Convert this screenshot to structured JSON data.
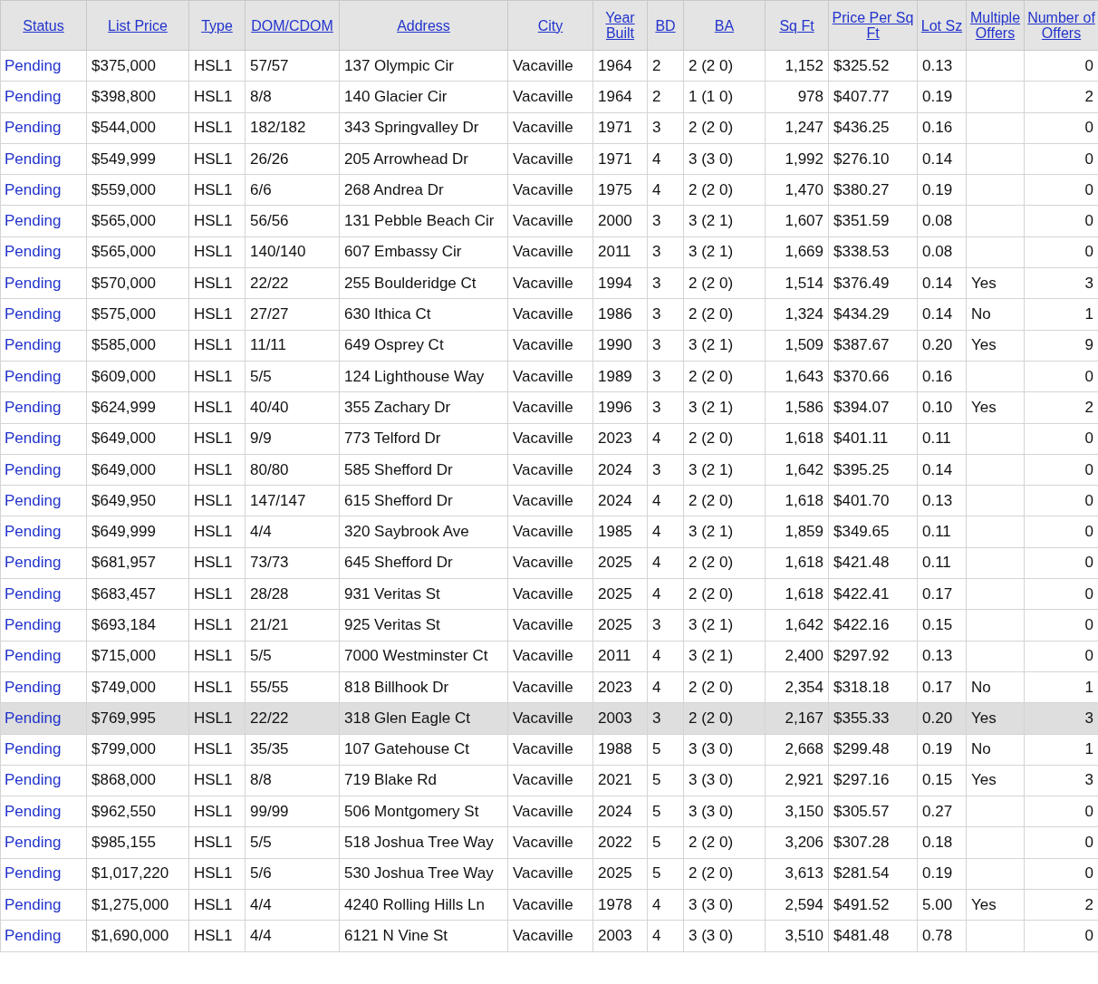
{
  "table": {
    "columns": [
      "Status",
      "List Price",
      "Type",
      "DOM/CDOM",
      "Address",
      "City",
      "Year Built",
      "BD",
      "BA",
      "Sq Ft",
      "Price Per Sq Ft",
      "Lot Sz",
      "Multiple Offers",
      "Number of Offers"
    ],
    "rows": [
      {
        "highlighted": false,
        "cells": [
          "Pending",
          "$375,000",
          "HSL1",
          "57/57",
          "137 Olympic Cir",
          "Vacaville",
          "1964",
          "2",
          "2 (2 0)",
          "1,152",
          "$325.52",
          "0.13",
          null,
          "0"
        ]
      },
      {
        "highlighted": false,
        "cells": [
          "Pending",
          "$398,800",
          "HSL1",
          "8/8",
          "140 Glacier Cir",
          "Vacaville",
          "1964",
          "2",
          "1 (1 0)",
          "978",
          "$407.77",
          "0.19",
          null,
          "2"
        ]
      },
      {
        "highlighted": false,
        "cells": [
          "Pending",
          "$544,000",
          "HSL1",
          "182/182",
          "343 Springvalley Dr",
          "Vacaville",
          "1971",
          "3",
          "2 (2 0)",
          "1,247",
          "$436.25",
          "0.16",
          null,
          "0"
        ]
      },
      {
        "highlighted": false,
        "cells": [
          "Pending",
          "$549,999",
          "HSL1",
          "26/26",
          "205 Arrowhead Dr",
          "Vacaville",
          "1971",
          "4",
          "3 (3 0)",
          "1,992",
          "$276.10",
          "0.14",
          null,
          "0"
        ]
      },
      {
        "highlighted": false,
        "cells": [
          "Pending",
          "$559,000",
          "HSL1",
          "6/6",
          "268 Andrea Dr",
          "Vacaville",
          "1975",
          "4",
          "2 (2 0)",
          "1,470",
          "$380.27",
          "0.19",
          null,
          "0"
        ]
      },
      {
        "highlighted": false,
        "cells": [
          "Pending",
          "$565,000",
          "HSL1",
          "56/56",
          "131 Pebble Beach Cir",
          "Vacaville",
          "2000",
          "3",
          "3 (2 1)",
          "1,607",
          "$351.59",
          "0.08",
          null,
          "0"
        ]
      },
      {
        "highlighted": false,
        "cells": [
          "Pending",
          "$565,000",
          "HSL1",
          "140/140",
          "607 Embassy Cir",
          "Vacaville",
          "2011",
          "3",
          "3 (2 1)",
          "1,669",
          "$338.53",
          "0.08",
          null,
          "0"
        ]
      },
      {
        "highlighted": false,
        "cells": [
          "Pending",
          "$570,000",
          "HSL1",
          "22/22",
          "255 Boulderidge Ct",
          "Vacaville",
          "1994",
          "3",
          "2 (2 0)",
          "1,514",
          "$376.49",
          "0.14",
          "Yes",
          "3"
        ]
      },
      {
        "highlighted": false,
        "cells": [
          "Pending",
          "$575,000",
          "HSL1",
          "27/27",
          "630 Ithica Ct",
          "Vacaville",
          "1986",
          "3",
          "2 (2 0)",
          "1,324",
          "$434.29",
          "0.14",
          "No",
          "1"
        ]
      },
      {
        "highlighted": false,
        "cells": [
          "Pending",
          "$585,000",
          "HSL1",
          "11/11",
          "649 Osprey Ct",
          "Vacaville",
          "1990",
          "3",
          "3 (2 1)",
          "1,509",
          "$387.67",
          "0.20",
          "Yes",
          "9"
        ]
      },
      {
        "highlighted": false,
        "cells": [
          "Pending",
          "$609,000",
          "HSL1",
          "5/5",
          "124 Lighthouse Way",
          "Vacaville",
          "1989",
          "3",
          "2 (2 0)",
          "1,643",
          "$370.66",
          "0.16",
          null,
          "0"
        ]
      },
      {
        "highlighted": false,
        "cells": [
          "Pending",
          "$624,999",
          "HSL1",
          "40/40",
          "355 Zachary Dr",
          "Vacaville",
          "1996",
          "3",
          "3 (2 1)",
          "1,586",
          "$394.07",
          "0.10",
          "Yes",
          "2"
        ]
      },
      {
        "highlighted": false,
        "cells": [
          "Pending",
          "$649,000",
          "HSL1",
          "9/9",
          "773 Telford Dr",
          "Vacaville",
          "2023",
          "4",
          "2 (2 0)",
          "1,618",
          "$401.11",
          "0.11",
          null,
          "0"
        ]
      },
      {
        "highlighted": false,
        "cells": [
          "Pending",
          "$649,000",
          "HSL1",
          "80/80",
          "585 Shefford Dr",
          "Vacaville",
          "2024",
          "3",
          "3 (2 1)",
          "1,642",
          "$395.25",
          "0.14",
          null,
          "0"
        ]
      },
      {
        "highlighted": false,
        "cells": [
          "Pending",
          "$649,950",
          "HSL1",
          "147/147",
          "615 Shefford Dr",
          "Vacaville",
          "2024",
          "4",
          "2 (2 0)",
          "1,618",
          "$401.70",
          "0.13",
          null,
          "0"
        ]
      },
      {
        "highlighted": false,
        "cells": [
          "Pending",
          "$649,999",
          "HSL1",
          "4/4",
          "320 Saybrook Ave",
          "Vacaville",
          "1985",
          "4",
          "3 (2 1)",
          "1,859",
          "$349.65",
          "0.11",
          null,
          "0"
        ]
      },
      {
        "highlighted": false,
        "cells": [
          "Pending",
          "$681,957",
          "HSL1",
          "73/73",
          "645 Shefford Dr",
          "Vacaville",
          "2025",
          "4",
          "2 (2 0)",
          "1,618",
          "$421.48",
          "0.11",
          null,
          "0"
        ]
      },
      {
        "highlighted": false,
        "cells": [
          "Pending",
          "$683,457",
          "HSL1",
          "28/28",
          "931 Veritas St",
          "Vacaville",
          "2025",
          "4",
          "2 (2 0)",
          "1,618",
          "$422.41",
          "0.17",
          null,
          "0"
        ]
      },
      {
        "highlighted": false,
        "cells": [
          "Pending",
          "$693,184",
          "HSL1",
          "21/21",
          "925 Veritas St",
          "Vacaville",
          "2025",
          "3",
          "3 (2 1)",
          "1,642",
          "$422.16",
          "0.15",
          null,
          "0"
        ]
      },
      {
        "highlighted": false,
        "cells": [
          "Pending",
          "$715,000",
          "HSL1",
          "5/5",
          "7000 Westminster Ct",
          "Vacaville",
          "2011",
          "4",
          "3 (2 1)",
          "2,400",
          "$297.92",
          "0.13",
          null,
          "0"
        ]
      },
      {
        "highlighted": false,
        "cells": [
          "Pending",
          "$749,000",
          "HSL1",
          "55/55",
          "818 Billhook Dr",
          "Vacaville",
          "2023",
          "4",
          "2 (2 0)",
          "2,354",
          "$318.18",
          "0.17",
          "No",
          "1"
        ]
      },
      {
        "highlighted": true,
        "cells": [
          "Pending",
          "$769,995",
          "HSL1",
          "22/22",
          "318 Glen Eagle Ct",
          "Vacaville",
          "2003",
          "3",
          "2 (2 0)",
          "2,167",
          "$355.33",
          "0.20",
          "Yes",
          "3"
        ]
      },
      {
        "highlighted": false,
        "cells": [
          "Pending",
          "$799,000",
          "HSL1",
          "35/35",
          "107 Gatehouse Ct",
          "Vacaville",
          "1988",
          "5",
          "3 (3 0)",
          "2,668",
          "$299.48",
          "0.19",
          "No",
          "1"
        ]
      },
      {
        "highlighted": false,
        "cells": [
          "Pending",
          "$868,000",
          "HSL1",
          "8/8",
          "719 Blake Rd",
          "Vacaville",
          "2021",
          "5",
          "3 (3 0)",
          "2,921",
          "$297.16",
          "0.15",
          "Yes",
          "3"
        ]
      },
      {
        "highlighted": false,
        "cells": [
          "Pending",
          "$962,550",
          "HSL1",
          "99/99",
          "506 Montgomery St",
          "Vacaville",
          "2024",
          "5",
          "3 (3 0)",
          "3,150",
          "$305.57",
          "0.27",
          null,
          "0"
        ]
      },
      {
        "highlighted": false,
        "cells": [
          "Pending",
          "$985,155",
          "HSL1",
          "5/5",
          "518 Joshua Tree Way",
          "Vacaville",
          "2022",
          "5",
          "2 (2 0)",
          "3,206",
          "$307.28",
          "0.18",
          null,
          "0"
        ]
      },
      {
        "highlighted": false,
        "cells": [
          "Pending",
          "$1,017,220",
          "HSL1",
          "5/6",
          "530 Joshua Tree Way",
          "Vacaville",
          "2025",
          "5",
          "2 (2 0)",
          "3,613",
          "$281.54",
          "0.19",
          null,
          "0"
        ]
      },
      {
        "highlighted": false,
        "cells": [
          "Pending",
          "$1,275,000",
          "HSL1",
          "4/4",
          "4240 Rolling Hills Ln",
          "Vacaville",
          "1978",
          "4",
          "3 (3 0)",
          "2,594",
          "$491.52",
          "5.00",
          "Yes",
          "2"
        ]
      },
      {
        "highlighted": false,
        "cells": [
          "Pending",
          "$1,690,000",
          "HSL1",
          "4/4",
          "6121 N Vine St",
          "Vacaville",
          "2003",
          "4",
          "3 (3 0)",
          "3,510",
          "$481.48",
          "0.78",
          null,
          "0"
        ]
      }
    ]
  }
}
